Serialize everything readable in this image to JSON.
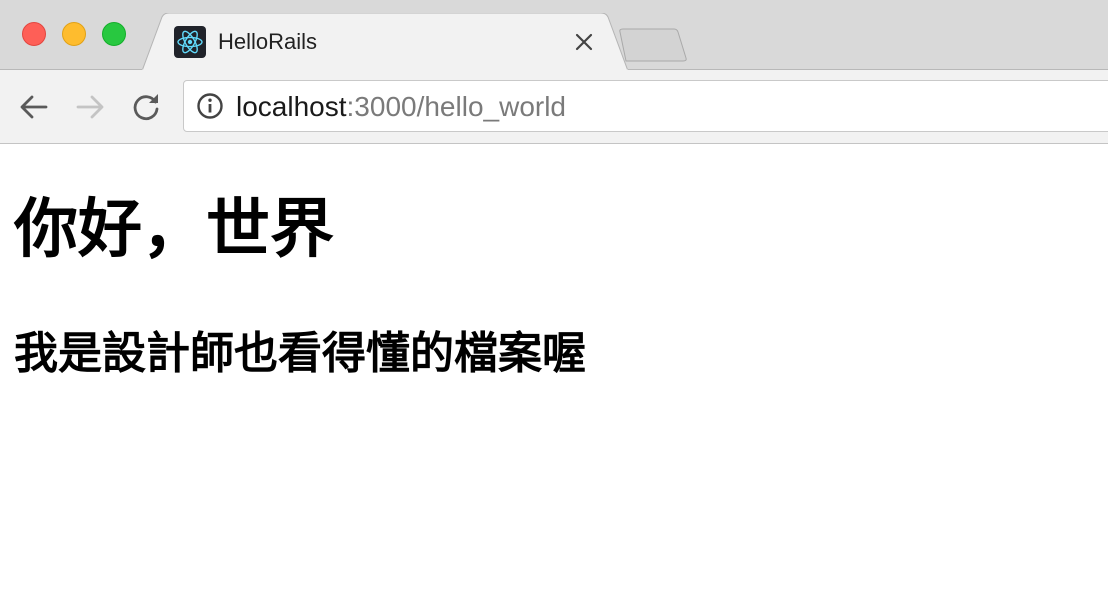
{
  "browser": {
    "tab": {
      "title": "HelloRails",
      "favicon_icon": "react-atom-icon"
    },
    "address_bar": {
      "host": "localhost",
      "rest": ":3000/hello_world"
    },
    "colors": {
      "close": "#fe5f57",
      "minimize": "#febc2e",
      "maximize": "#28c840",
      "url_host": "#1a1a1a",
      "url_rest": "#7a7a7a",
      "favicon_bg": "#20232a",
      "favicon_atom": "#61dafb"
    }
  },
  "page": {
    "heading": "你好，世界",
    "subheading": "我是設計師也看得懂的檔案喔"
  }
}
